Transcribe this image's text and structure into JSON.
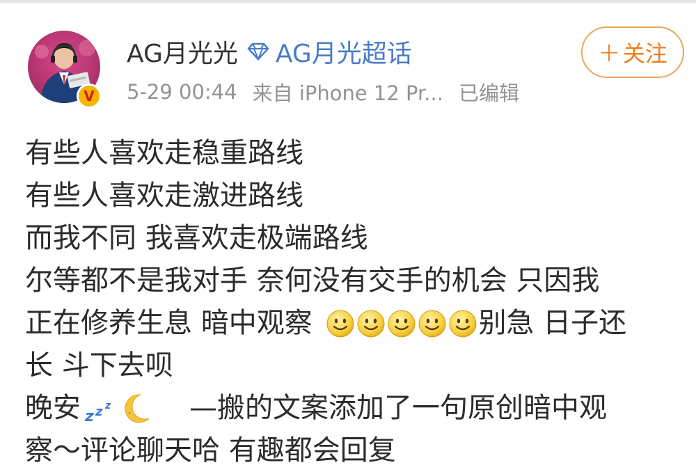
{
  "post": {
    "author": {
      "name": "AG月光光",
      "verified_badge": "V",
      "super_topic": "AG月光超话"
    },
    "meta": {
      "timestamp": "5-29 00:44",
      "source": "来自 iPhone 12 Pr...",
      "edited": "已编辑"
    },
    "follow_button": {
      "plus": "+",
      "label": "关注"
    },
    "content": {
      "line1": "有些人喜欢走稳重路线",
      "line2": "有些人喜欢走激进路线",
      "line3": "而我不同 我喜欢走极端路线",
      "line4": "尔等都不是我对手 奈何没有交手的机会  只因我",
      "line5_before_emoji": "正在修养生息 暗中观察 ",
      "line5_after_emoji": "别急 日子还",
      "line6": "长 斗下去呗",
      "line7_before_icons": "晚安",
      "line7_after_icons": "—搬的文案添加了一句原创暗中观",
      "line8": "察～评论聊天哈 有趣都会回复"
    },
    "icons": {
      "avatar": "avatar-image",
      "verified": "verified-badge-icon",
      "super_topic": "diamond-icon",
      "smile_emoji": "smile-emoji-icon",
      "smile_count": 5,
      "sleep": "zzz-icon",
      "moon": "crescent-moon-icon"
    },
    "colors": {
      "link_blue": "#4a7bc8",
      "follow_orange": "#f07b1c",
      "meta_gray": "#939393",
      "badge_gold": "#f5b400"
    }
  }
}
